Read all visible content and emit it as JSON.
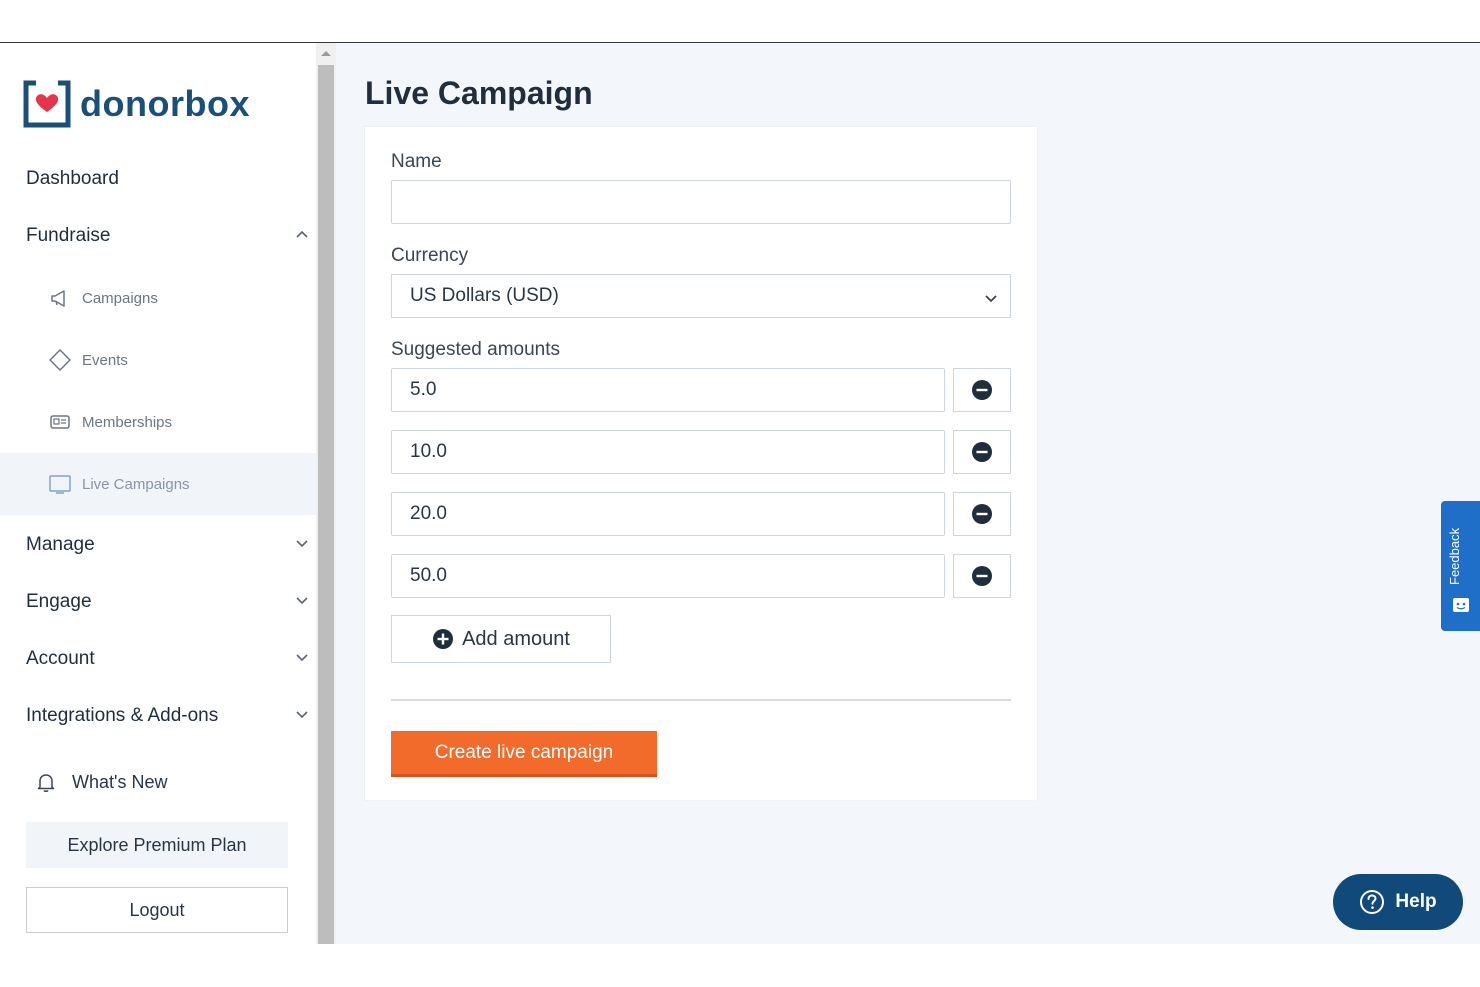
{
  "brand": {
    "name": "donorbox",
    "color": "#1a4f7a",
    "heart_color": "#e8334a"
  },
  "sidebar": {
    "items": [
      {
        "label": "Dashboard"
      },
      {
        "label": "Fundraise",
        "expanded": true
      },
      {
        "label": "Manage"
      },
      {
        "label": "Engage"
      },
      {
        "label": "Account"
      },
      {
        "label": "Integrations & Add-ons"
      }
    ],
    "fundraise_sub": [
      {
        "label": "Campaigns",
        "icon": "megaphone-icon"
      },
      {
        "label": "Events",
        "icon": "ticket-icon"
      },
      {
        "label": "Memberships",
        "icon": "membership-card-icon"
      },
      {
        "label": "Live Campaigns",
        "icon": "monitor-icon",
        "active": true
      }
    ],
    "whats_new": "What's New",
    "explore_premium": "Explore Premium Plan",
    "logout": "Logout"
  },
  "main": {
    "title": "Live Campaign",
    "form": {
      "name_label": "Name",
      "name_value": "",
      "currency_label": "Currency",
      "currency_value": "US Dollars (USD)",
      "suggested_label": "Suggested amounts",
      "amounts": [
        "5.0",
        "10.0",
        "20.0",
        "50.0"
      ],
      "add_amount": "Add amount",
      "submit": "Create live campaign"
    }
  },
  "feedback_tab": "Feedback",
  "help_button": "Help",
  "colors": {
    "accent": "#f26b2b",
    "help_bg": "#114a7a",
    "feedback_bg": "#1f6fc8"
  }
}
